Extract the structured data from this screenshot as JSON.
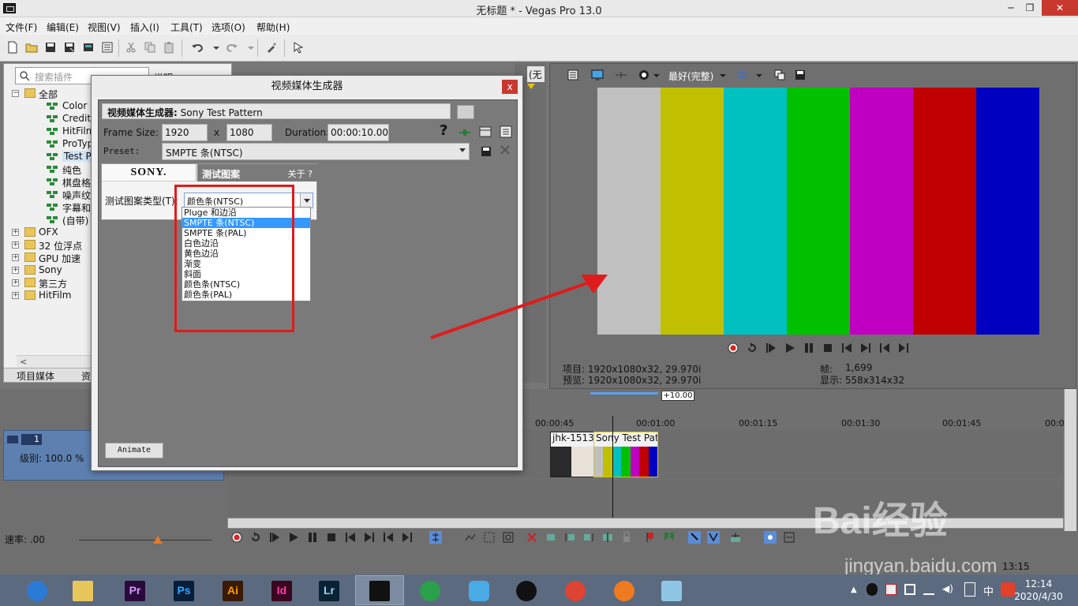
{
  "window": {
    "title": "无标题 * - Vegas Pro 13.0",
    "min": "─",
    "max": "❐",
    "close": "✕"
  },
  "menu": [
    "文件(F)",
    "编辑(E)",
    "视图(V)",
    "插入(I)",
    "工具(T)",
    "选项(O)",
    "帮助(H)"
  ],
  "plugins": {
    "search_placeholder": "搜索插件",
    "header_partial": "说明",
    "tree": [
      {
        "label": "全部",
        "kind": "folder",
        "expand": "−"
      },
      {
        "label": "Color C",
        "kind": "fx"
      },
      {
        "label": "Credit",
        "kind": "fx"
      },
      {
        "label": "HitFilm",
        "kind": "fx"
      },
      {
        "label": "ProTyp",
        "kind": "fx"
      },
      {
        "label": "Test Pa",
        "kind": "fx",
        "selected": true
      },
      {
        "label": "纯色",
        "kind": "fx"
      },
      {
        "label": "棋盘格",
        "kind": "fx"
      },
      {
        "label": "噪声纹",
        "kind": "fx"
      },
      {
        "label": "字幕和",
        "kind": "fx"
      },
      {
        "label": "(自带)",
        "kind": "fx"
      },
      {
        "label": "OFX",
        "kind": "folder",
        "expand": "+"
      },
      {
        "label": "32 位浮点",
        "kind": "folder",
        "expand": "+"
      },
      {
        "label": "GPU 加速",
        "kind": "folder",
        "expand": "+"
      },
      {
        "label": "Sony",
        "kind": "folder",
        "expand": "+"
      },
      {
        "label": "第三方",
        "kind": "folder",
        "expand": "+"
      },
      {
        "label": "HitFilm",
        "kind": "folder",
        "expand": "+"
      }
    ],
    "tabs": [
      "项目媒体",
      "资"
    ]
  },
  "mid_label": "(无",
  "preview": {
    "quality": "最好(完整)",
    "bar_colors": [
      "#c0c0c0",
      "#c0c000",
      "#00c0c0",
      "#00c000",
      "#c000c0",
      "#c00000",
      "#0000c0"
    ],
    "project_label": "项目: 1920x1080x32, 29.970i",
    "preview_label": "预览: 1920x1080x32, 29.970i",
    "frame_label": "帧:",
    "frame_value": "1,699",
    "display_label": "显示: 558x314x32"
  },
  "timeline": {
    "zoom": "+10.00",
    "track_number": "1",
    "level": "级别: 100.0 %",
    "ruler": [
      "00:00:45",
      "00:01:00",
      "00:01:15",
      "00:01:30",
      "00:01:45",
      "00:0"
    ],
    "clip1": "jhk-1513",
    "clip2": "Sony Test Patt",
    "rate": "速率: .00",
    "time": "13:15"
  },
  "dialog": {
    "title": "视频媒体生成器",
    "close": "x",
    "generator_label": "视频媒体生成器:",
    "generator_value": "Sony Test Pattern",
    "frame_size_label": "Frame Size:",
    "width": "1920",
    "x": "x",
    "height": "1080",
    "duration_label": "Duration:",
    "duration": "00:00:10.00",
    "help": "?",
    "preset_label": "Preset:",
    "preset_value": "SMPTE 条(NTSC)",
    "sony": "SONY.",
    "tab_title": "测试图案",
    "about": "关于  ?",
    "type_label": "测试图案类型(T):",
    "type_value": "颜色条(NTSC)",
    "options": [
      "Pluge 和边沿",
      "SMPTE 条(NTSC)",
      "SMPTE 条(PAL)",
      "白色边沿",
      "黄色边沿",
      "渐变",
      "斜面",
      "颜色条(NTSC)",
      "颜色条(PAL)"
    ],
    "selected_option": 1,
    "animate": "Animate"
  },
  "taskbar": {
    "apps": [
      {
        "name": "browser-icon",
        "text": ""
      },
      {
        "name": "file-explorer-icon",
        "text": ""
      },
      {
        "name": "premiere-icon",
        "text": "Pr"
      },
      {
        "name": "photoshop-icon",
        "text": "Ps"
      },
      {
        "name": "illustrator-icon",
        "text": "Ai"
      },
      {
        "name": "indesign-icon",
        "text": "Id"
      },
      {
        "name": "lightroom-icon",
        "text": "Lr"
      },
      {
        "name": "vegas-icon",
        "text": ""
      },
      {
        "name": "umbrella-icon",
        "text": ""
      },
      {
        "name": "cat-icon",
        "text": ""
      },
      {
        "name": "qq-icon",
        "text": ""
      },
      {
        "name": "chrome-icon",
        "text": ""
      },
      {
        "name": "media-icon",
        "text": ""
      },
      {
        "name": "glass-icon",
        "text": ""
      }
    ],
    "ime": "中",
    "clock_time": "12:14",
    "clock_date": "2020/4/30"
  },
  "watermark": {
    "brand": "Bai经验",
    "url": "jingyan.baidu.com"
  }
}
